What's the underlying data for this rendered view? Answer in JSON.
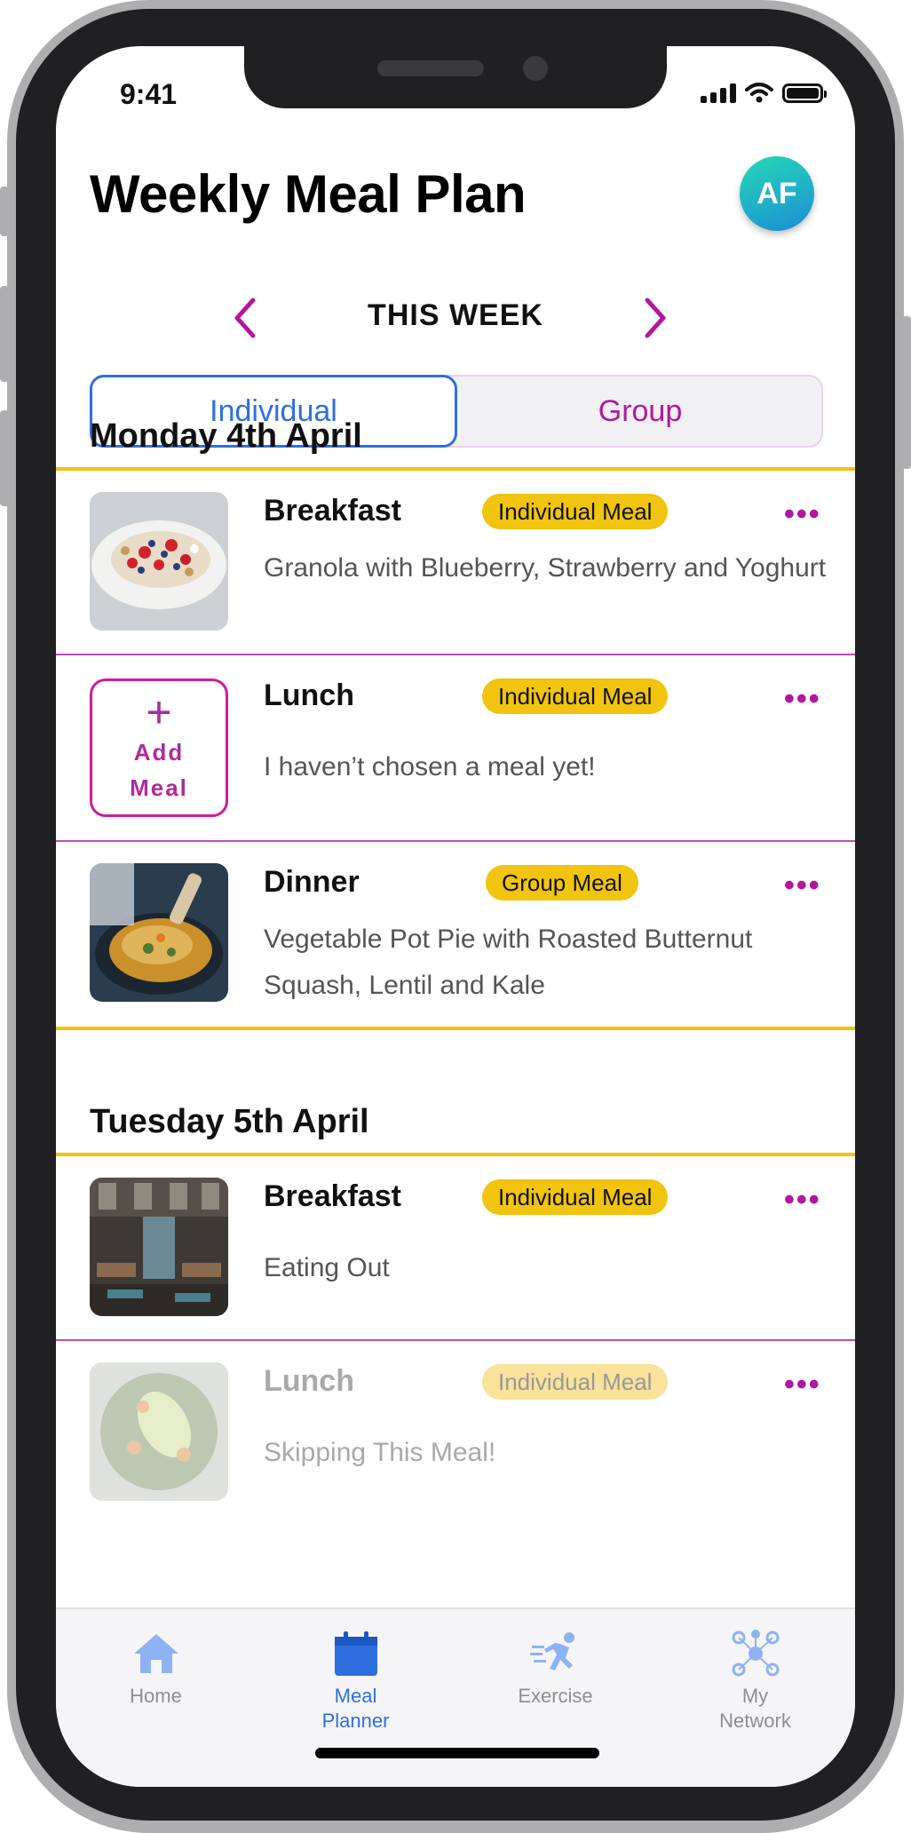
{
  "status_bar": {
    "time": "9:41"
  },
  "header": {
    "title": "Weekly Meal Plan",
    "avatar_initials": "AF"
  },
  "week_nav": {
    "label": "THIS WEEK",
    "prev_icon": "chevron-left-icon",
    "next_icon": "chevron-right-icon"
  },
  "segments": {
    "individual": "Individual",
    "group": "Group",
    "selected": "Individual"
  },
  "days": [
    {
      "title": "Monday 4th April",
      "meals": [
        {
          "type": "Breakfast",
          "badge": "Individual Meal",
          "description": "Granola with Blueberry, Strawberry and Yoghurt",
          "image": "granola-bowl"
        },
        {
          "type": "Lunch",
          "badge": "Individual Meal",
          "description": "I haven’t chosen a meal yet!",
          "add_meal_label_1": "Add",
          "add_meal_label_2": "Meal"
        },
        {
          "type": "Dinner",
          "badge": "Group Meal",
          "description": "Vegetable Pot Pie with Roasted Butternut Squash, Lentil and Kale",
          "image": "pot-pie"
        }
      ]
    },
    {
      "title": "Tuesday 5th April",
      "meals": [
        {
          "type": "Breakfast",
          "badge": "Individual Meal",
          "description": "Eating Out",
          "image": "restaurant"
        },
        {
          "type": "Lunch",
          "badge": "Individual Meal",
          "description": "Skipping This Meal!",
          "image": "salad",
          "skipped": true
        }
      ]
    }
  ],
  "more_glyph": "•••",
  "tab_bar": [
    {
      "label": "Home",
      "icon": "home-icon",
      "active": false
    },
    {
      "label": "Meal Planner",
      "icon": "calendar-icon",
      "active": true
    },
    {
      "label": "Exercise",
      "icon": "runner-icon",
      "active": false
    },
    {
      "label": "My Network",
      "icon": "network-icon",
      "active": false
    }
  ],
  "colors": {
    "accent_blue": "#2e6fe0",
    "accent_magenta": "#b3169f",
    "badge_yellow": "#f1c40f"
  }
}
